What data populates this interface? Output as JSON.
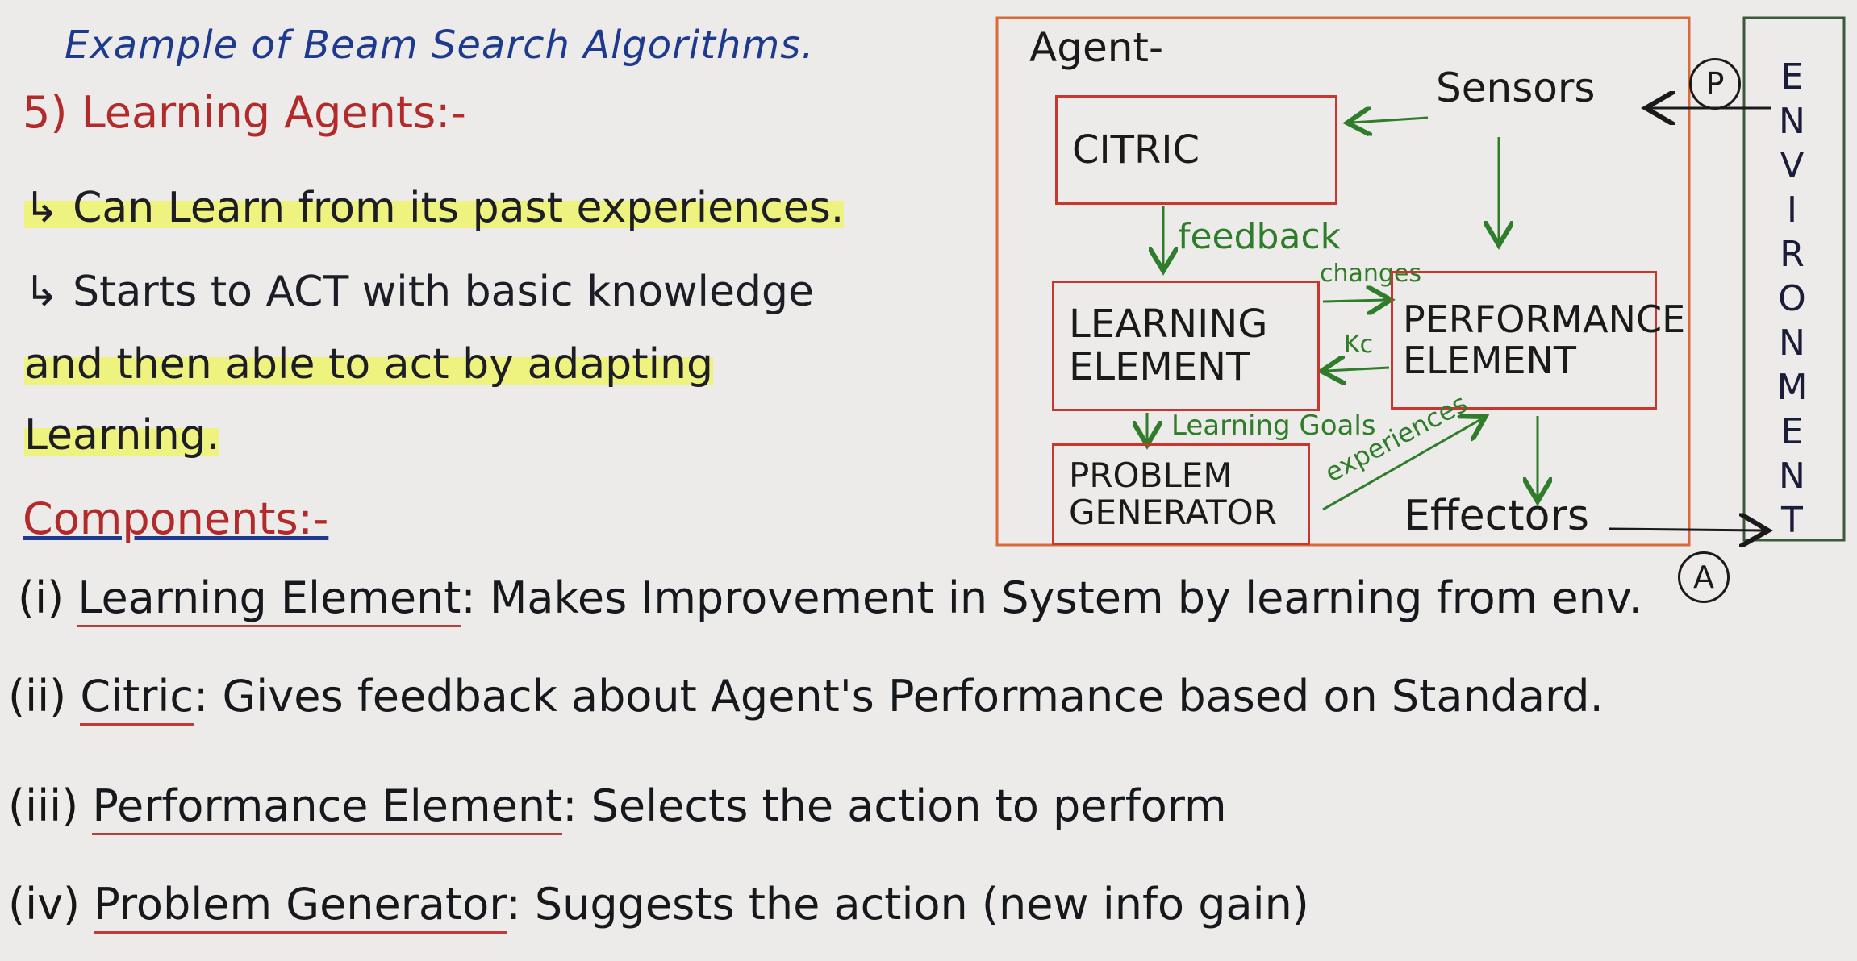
{
  "heading": {
    "scribbled": "Example of Beam Search Algorithms.",
    "section": "5) Learning Agents:-"
  },
  "bullets": [
    "↳ Can Learn from its past experiences.",
    "↳ Starts to ACT with basic knowledge",
    "and then able to act by adapting",
    "Learning."
  ],
  "components_heading": "Components:-",
  "components": [
    {
      "num": "(i)",
      "name": "Learning Element",
      "desc": ": Makes Improvement in System by learning from env."
    },
    {
      "num": "(ii)",
      "name": "Citric",
      "desc": ": Gives feedback about Agent's Performance based on Standard."
    },
    {
      "num": "(iii)",
      "name": "Performance Element",
      "desc": ": Selects the action to perform"
    },
    {
      "num": "(iv)",
      "name": "Problem Generator",
      "desc": ": Suggests the action (new info gain)"
    }
  ],
  "diagram": {
    "agent_label": "Agent-",
    "critic": "CITRIC",
    "learning_element": [
      "LEARNING",
      "ELEMENT"
    ],
    "performance_element": [
      "PERFORMANCE",
      "ELEMENT"
    ],
    "problem_generator": [
      "PROBLEM",
      "GENERATOR"
    ],
    "sensors": "Sensors",
    "effectors": "Effectors",
    "environment": "ENVIRONMENT",
    "p_marker": "P",
    "a_marker": "A",
    "edge_labels": {
      "feedback": "feedback",
      "changes": "changes",
      "knowledge": "Kc",
      "learning_goals": "Learning Goals",
      "experiences": "experiences"
    }
  },
  "colors": {
    "background": "#ecebe9",
    "box_border": "#c8362d",
    "agent_border": "#d96a3a",
    "arrow_green": "#2f7d2a",
    "highlight": "#eef27f",
    "heading_blue": "#1d3a8f",
    "underline_red": "#c03a3a"
  }
}
